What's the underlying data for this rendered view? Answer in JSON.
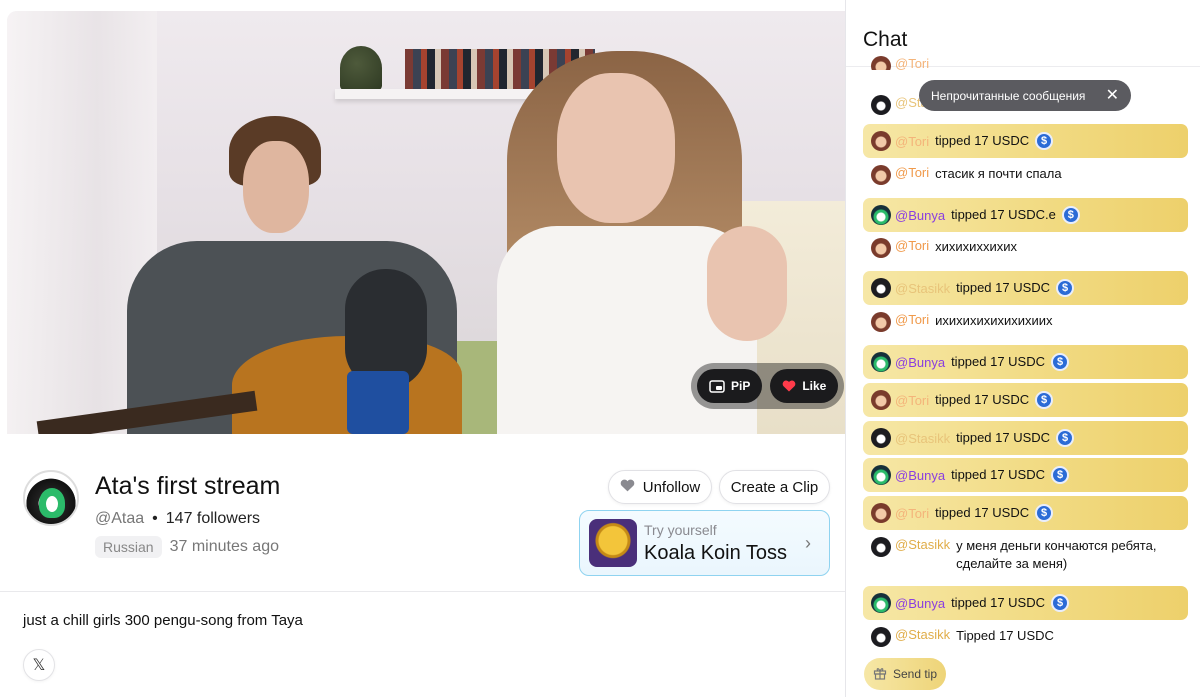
{
  "video": {
    "pip_label": "PiP",
    "like_label": "Like"
  },
  "stream": {
    "title": "Ata's first stream",
    "handle": "@Ataa",
    "separator": "•",
    "followers": "147 followers",
    "language": "Russian",
    "started": "37 minutes ago",
    "description": "just a chill girls 300 pengu-song from Taya"
  },
  "actions": {
    "unfollow_label": "Unfollow",
    "clip_label": "Create a Clip"
  },
  "game": {
    "subtitle": "Try yourself",
    "title": "Koala Koin Toss",
    "chevron": "›"
  },
  "social": {
    "x_label": "𝕏"
  },
  "chat": {
    "title": "Chat",
    "unread_banner": "Непрочитанные сообщения",
    "unread_close": "✕",
    "send_tip_label": "Send tip",
    "partial_top": [
      {
        "user": "@Tori"
      },
      {
        "user": "@Stasikk"
      }
    ],
    "messages": [
      {
        "user": "@Tori",
        "text": "tipped 17 USDC",
        "tip": true
      },
      {
        "user": "@Tori",
        "text": "стасик я почти спала",
        "tip": false
      },
      {
        "user": "@Bunya",
        "text": "tipped 17 USDC.e",
        "tip": true
      },
      {
        "user": "@Tori",
        "text": "хихихиххихих",
        "tip": false
      },
      {
        "user": "@Stasikk",
        "text": "tipped 17 USDC",
        "tip": true
      },
      {
        "user": "@Tori",
        "text": "ихихихихихихихиих",
        "tip": false
      },
      {
        "user": "@Bunya",
        "text": "tipped 17 USDC",
        "tip": true
      },
      {
        "user": "@Tori",
        "text": "tipped 17 USDC",
        "tip": true
      },
      {
        "user": "@Stasikk",
        "text": "tipped 17 USDC",
        "tip": true
      },
      {
        "user": "@Bunya",
        "text": "tipped 17 USDC",
        "tip": true
      },
      {
        "user": "@Tori",
        "text": "tipped 17 USDC",
        "tip": true
      },
      {
        "user": "@Stasikk",
        "text": "у меня деньги кончаются ребята, сделайте за меня)",
        "tip": false
      },
      {
        "user": "@Bunya",
        "text": "tipped 17 USDC",
        "tip": true
      },
      {
        "user": "@Stasikk",
        "text": "Tipped 17 USDC",
        "tip": false
      }
    ],
    "usdc_symbol": "$"
  },
  "colors": {
    "tip_gold": "#f2dc86",
    "tori_name": "#f09a4b",
    "stasikk_name": "#e0ad49",
    "bunya_name": "#8a3fe0",
    "usdc_blue": "#2b6bd6",
    "game_border": "#8fd3f0"
  }
}
